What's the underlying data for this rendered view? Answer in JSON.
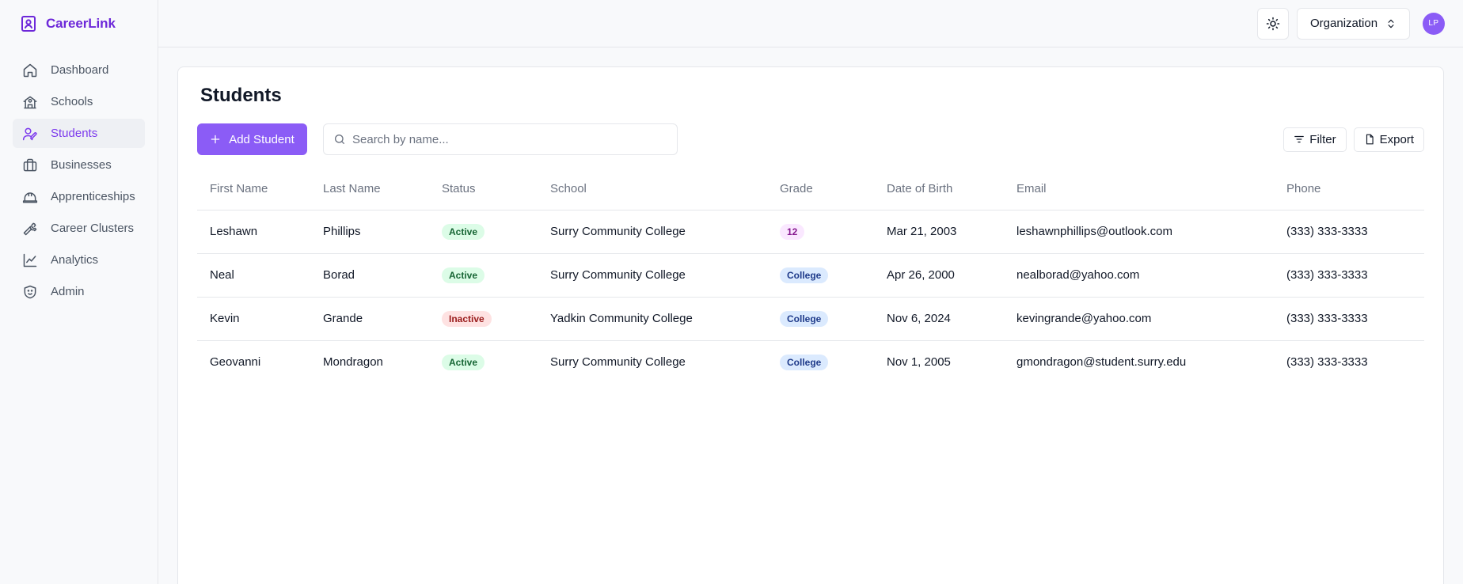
{
  "brand": {
    "name": "CareerLink",
    "icon": "badge-icon"
  },
  "sidebar": {
    "items": [
      {
        "label": "Dashboard",
        "icon": "home-icon",
        "active": false
      },
      {
        "label": "Schools",
        "icon": "school-icon",
        "active": false
      },
      {
        "label": "Students",
        "icon": "student-icon",
        "active": true
      },
      {
        "label": "Businesses",
        "icon": "briefcase-icon",
        "active": false
      },
      {
        "label": "Apprenticeships",
        "icon": "hardhat-icon",
        "active": false
      },
      {
        "label": "Career Clusters",
        "icon": "wrench-icon",
        "active": false
      },
      {
        "label": "Analytics",
        "icon": "chart-line-icon",
        "active": false
      },
      {
        "label": "Admin",
        "icon": "shield-icon",
        "active": false
      }
    ]
  },
  "topbar": {
    "organization_label": "Organization",
    "avatar_initials": "LP"
  },
  "page": {
    "title": "Students",
    "add_button_label": "Add Student",
    "search_placeholder": "Search by name...",
    "filter_label": "Filter",
    "export_label": "Export"
  },
  "table": {
    "columns": [
      "First Name",
      "Last Name",
      "Status",
      "School",
      "Grade",
      "Date of Birth",
      "Email",
      "Phone"
    ],
    "rows": [
      {
        "first": "Leshawn",
        "last": "Phillips",
        "status": "Active",
        "school": "Surry Community College",
        "grade": "12",
        "dob": "Mar 21, 2003",
        "email": "leshawnphillips@outlook.com",
        "phone": "(333) 333-3333"
      },
      {
        "first": "Neal",
        "last": "Borad",
        "status": "Active",
        "school": "Surry Community College",
        "grade": "College",
        "dob": "Apr 26, 2000",
        "email": "nealborad@yahoo.com",
        "phone": "(333) 333-3333"
      },
      {
        "first": "Kevin",
        "last": "Grande",
        "status": "Inactive",
        "school": "Yadkin Community College",
        "grade": "College",
        "dob": "Nov 6, 2024",
        "email": "kevingrande@yahoo.com",
        "phone": "(333) 333-3333"
      },
      {
        "first": "Geovanni",
        "last": "Mondragon",
        "status": "Active",
        "school": "Surry Community College",
        "grade": "College",
        "dob": "Nov 1, 2005",
        "email": "gmondragon@student.surry.edu",
        "phone": "(333) 333-3333"
      }
    ]
  },
  "colors": {
    "accent": "#8b5cf6",
    "brand": "#6d28d9",
    "active_badge": "#dcfce7",
    "inactive_badge": "#fee2e2"
  }
}
